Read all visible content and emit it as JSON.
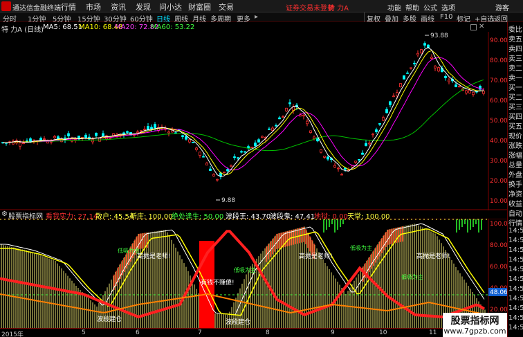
{
  "menubar": {
    "app_name": "通达信金融终端",
    "items": [
      "行情",
      "市场",
      "资讯",
      "发现",
      "问小达",
      "财富圈",
      "交易"
    ],
    "login_warning": "证券交易未登录",
    "stock_name": "特 力A",
    "right_items": [
      "功能",
      "帮助",
      "公式",
      "选项"
    ],
    "user": "游客"
  },
  "toolbar": {
    "periods": [
      "分时",
      "1分钟",
      "5分钟",
      "15分钟",
      "30分钟",
      "60分钟",
      "日线",
      "周线",
      "月线",
      "多周期",
      "更多"
    ],
    "selected": "日线",
    "tools": [
      "复权",
      "叠加",
      "多股",
      "画线",
      "F10",
      "标记",
      "+自选",
      "返回"
    ]
  },
  "main_legend": {
    "title": "特 力A (日线)",
    "ma5": "MA5: 68.51",
    "ma10": "MA10: 68.48",
    "ma20": "MA20: 72.82",
    "ma60": "MA60: 53.22"
  },
  "indicator_legend": {
    "name": "股票指标网",
    "items": [
      {
        "text": "看我实力: 27.14",
        "color": "#ff3030"
      },
      {
        "text": "散户: 45.54",
        "color": "#ffff40"
      },
      {
        "text": "新庄: 100.00",
        "color": "#ffff40"
      },
      {
        "text": "绝处逢生: 50.00",
        "color": "#40ff40"
      },
      {
        "text": "波段王: 43.70",
        "color": "#ffffff"
      },
      {
        "text": "波段鬼: 47.41",
        "color": "#ffffff"
      },
      {
        "text": "地狱: 0.00",
        "color": "#ff3030"
      },
      {
        "text": "天堂: 100.00",
        "color": "#ffff40"
      }
    ]
  },
  "annotations": {
    "high_label": "93.88",
    "low_label": "9.88",
    "teacher_1": "高抛是老师!",
    "teacher_2": "高抛是老师!",
    "teacher_3": "高抛是老师!",
    "money_msg": "有钱不赚傻!",
    "low_absorb_1": "低吸为主",
    "low_absorb_2": "低吸为主",
    "low_absorb_3": "低吸为主",
    "low_absorb_4": "低吸为主",
    "wave_1": "波段建仓",
    "wave_2": "波段建仓"
  },
  "price_axis": [
    "90.00",
    "80.00",
    "70.00",
    "60.00",
    "50.00",
    "40.00",
    "30.00",
    "20.00",
    "10.00"
  ],
  "indicator_axis": [
    "100.00",
    "80.00",
    "60.00",
    "40.00",
    "20.00"
  ],
  "indicator_current": "48.06",
  "x_labels": [
    "2015年",
    "5",
    "6",
    "7",
    "8",
    "9",
    "10",
    "11"
  ],
  "sidebar": [
    "委比",
    "卖五",
    "卖四",
    "卖三",
    "卖二",
    "卖一",
    "买一",
    "买二",
    "买三",
    "买四",
    "买五",
    "现价",
    "涨跌",
    "涨幅",
    "总量",
    "外盘",
    "换手",
    "净资",
    "收益",
    "自动",
    "行情",
    "14:50",
    "14:50",
    "14:50",
    "14:50",
    "14:50",
    "14:50",
    "14:50",
    "14:50",
    "14:50",
    "14:50",
    "14:5"
  ],
  "watermark": {
    "line1": "股票指标网",
    "line2": "www.7gpzb.com"
  },
  "colors": {
    "up": "#ff3030",
    "down": "#00ffff",
    "ma5": "#ffffff",
    "ma10": "#ffff00",
    "ma20": "#ff00ff",
    "ma60": "#00c000",
    "accent": "#ff3030"
  }
}
